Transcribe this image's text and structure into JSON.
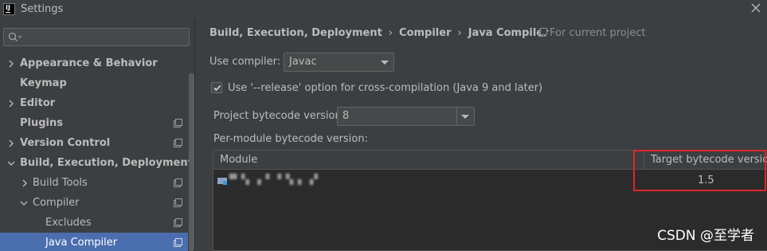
{
  "window": {
    "logo_text": "IJ",
    "title": "Settings"
  },
  "sidebar": {
    "search_placeholder": "",
    "items": [
      {
        "label": "Appearance & Behavior",
        "bold": true,
        "chevron": "right"
      },
      {
        "label": "Keymap",
        "bold": true
      },
      {
        "label": "Editor",
        "bold": true,
        "chevron": "right"
      },
      {
        "label": "Plugins",
        "bold": true,
        "project_icon": true
      },
      {
        "label": "Version Control",
        "bold": true,
        "chevron": "right",
        "project_icon": true
      },
      {
        "label": "Build, Execution, Deployment",
        "bold": true,
        "chevron": "down"
      },
      {
        "label": "Build Tools",
        "chevron": "right",
        "project_icon": true
      },
      {
        "label": "Compiler",
        "chevron": "down",
        "project_icon": true
      },
      {
        "label": "Excludes",
        "project_icon": true
      },
      {
        "label": "Java Compiler",
        "selected": true,
        "project_icon": true
      }
    ]
  },
  "breadcrumb": {
    "part1": "Build, Execution, Deployment",
    "separator": "›",
    "part2": "Compiler",
    "part3": "Java Compiler",
    "for_project": "For current project"
  },
  "form": {
    "use_compiler_label": "Use compiler:",
    "use_compiler_value": "Javac",
    "release_option_label": "Use '--release' option for cross-compilation (Java 9 and later)",
    "release_option_checked": true,
    "project_bytecode_label": "Project bytecode version:",
    "project_bytecode_value": "8",
    "per_module_label": "Per-module bytecode version:"
  },
  "table": {
    "col_module": "Module",
    "col_target": "Target bytecode version",
    "rows": [
      {
        "module": "▀▝▖▗ ▘▝ ▚ ▖▗▘",
        "target": "1.5"
      }
    ]
  },
  "watermark": "CSDN @至学者",
  "colors": {
    "background": "#3c3f41",
    "selection": "#4b6eaf",
    "table_bg": "#2b2b2b",
    "highlight_box": "#e0262b"
  }
}
